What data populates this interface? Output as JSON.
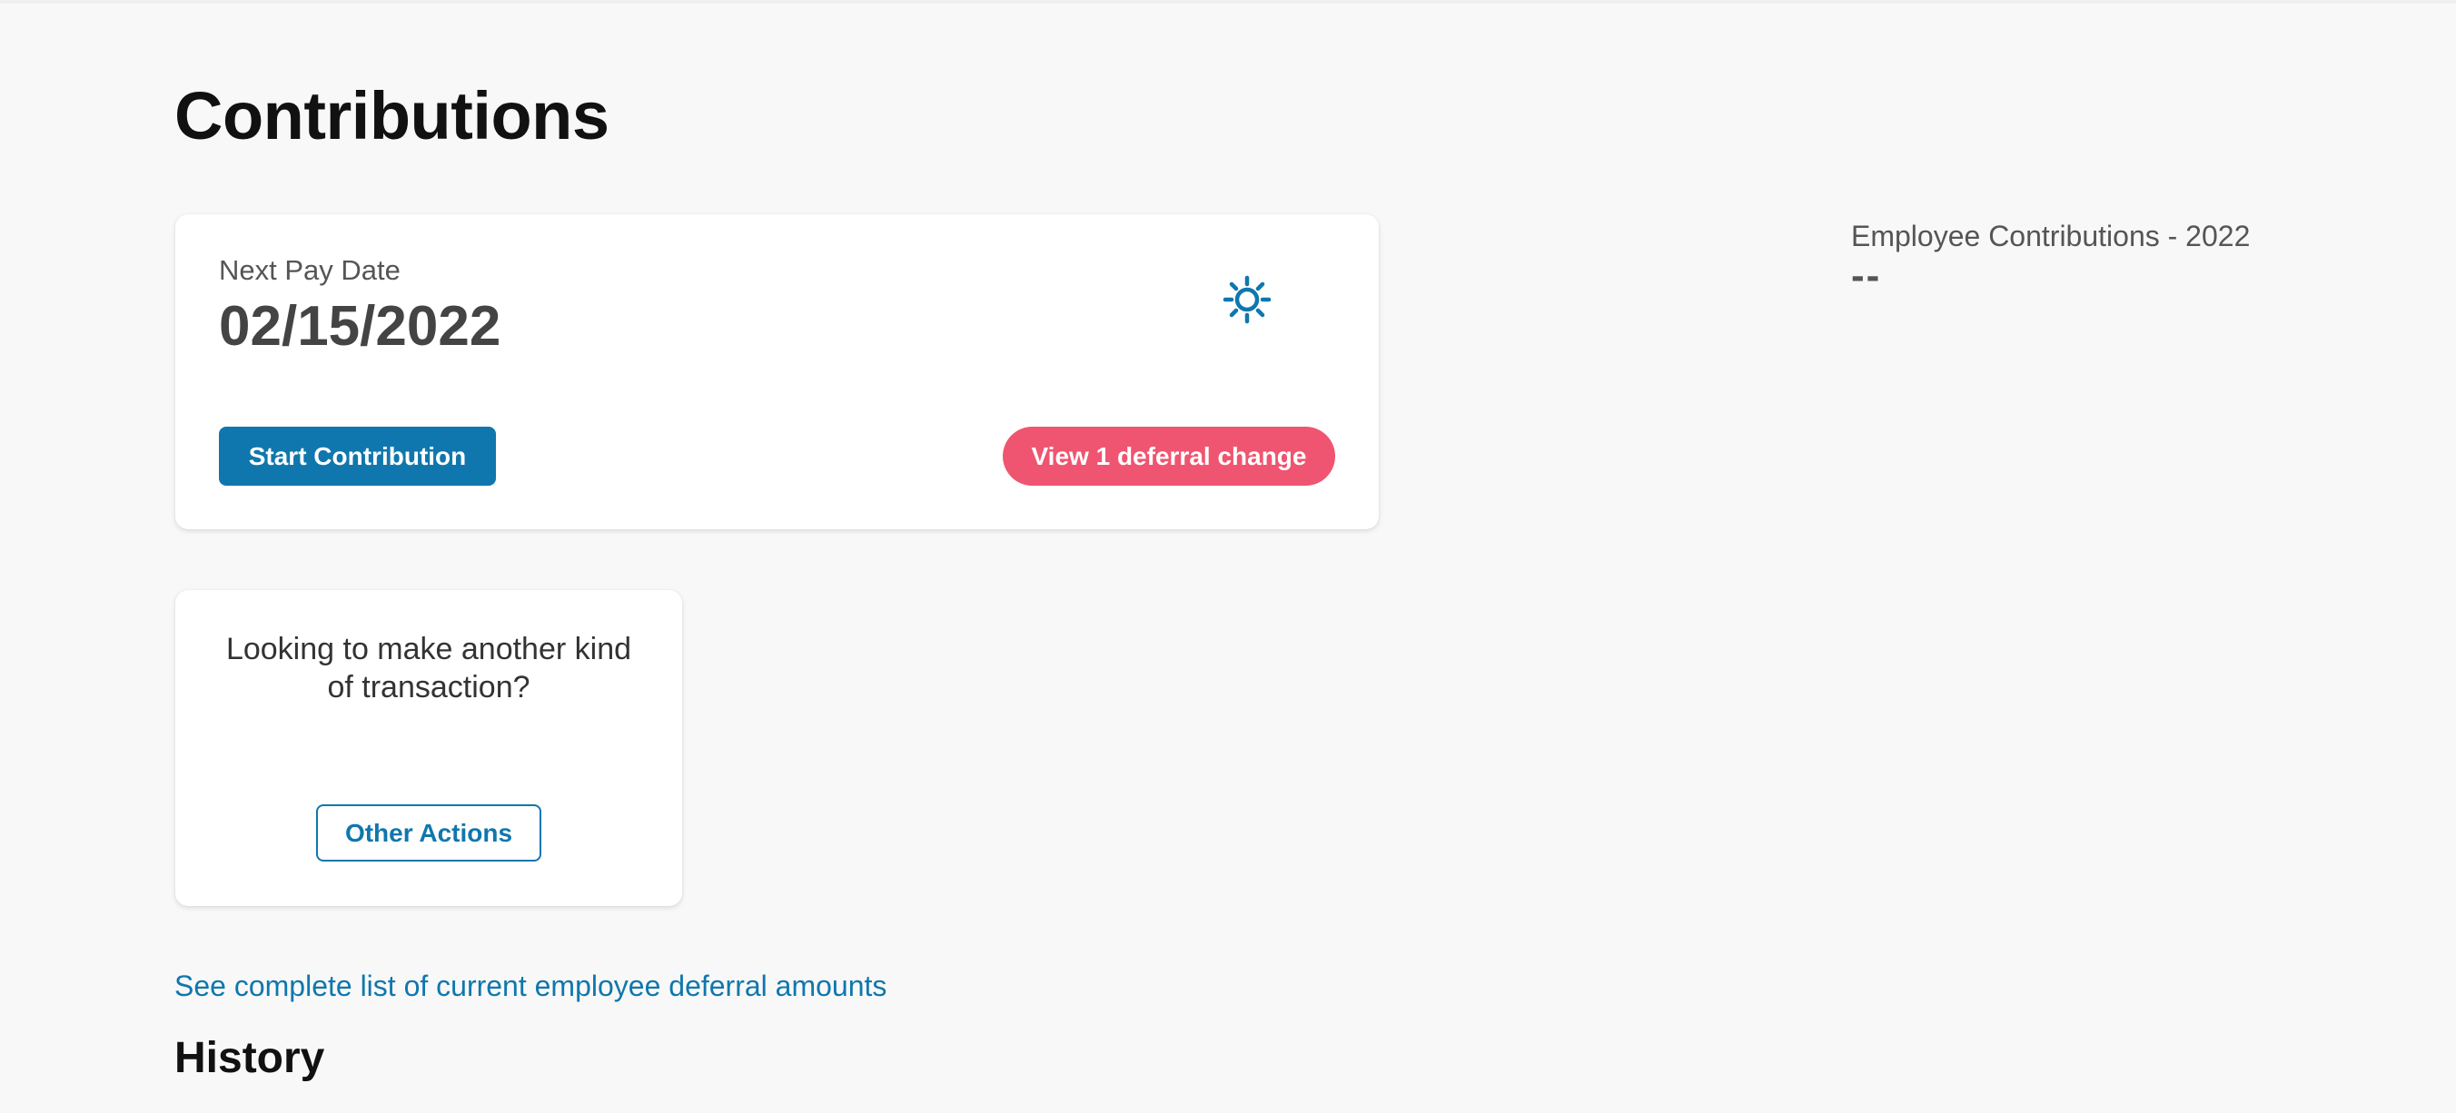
{
  "page": {
    "title": "Contributions"
  },
  "paydate_card": {
    "label": "Next Pay Date",
    "value": "02/15/2022",
    "settings_icon": "gear-icon",
    "start_button": "Start Contribution",
    "deferral_button": "View 1 deferral change"
  },
  "actions_card": {
    "prompt": "Looking to make another kind of transaction?",
    "button": "Other Actions"
  },
  "links": {
    "deferral_list": "See complete list of current employee deferral amounts"
  },
  "history": {
    "title": "History"
  },
  "summary": {
    "label": "Employee Contributions - 2022",
    "value": "--"
  },
  "colors": {
    "background": "#f8f8f8",
    "primary": "#0f77ad",
    "alert": "#ef5570",
    "text_muted": "#555555"
  }
}
